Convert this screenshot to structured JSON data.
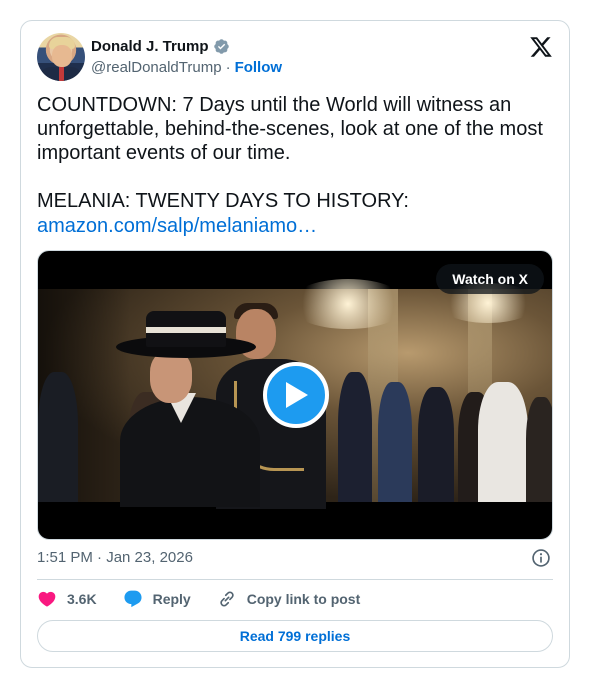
{
  "author": {
    "name": "Donald J. Trump",
    "handle": "@realDonaldTrump",
    "separator": "·",
    "follow_label": "Follow",
    "verified": true,
    "avatar_icon": "profile-avatar"
  },
  "platform_icon": "x-logo-icon",
  "tweet": {
    "text": "COUNTDOWN: 7 Days until the World will witness an\nunforgettable, behind-the-scenes, look at one of the most\nimportant events of our time.\n\nMELANIA: TWENTY DAYS TO HISTORY:",
    "link": "amazon.com/salp/melaniamo…"
  },
  "media": {
    "watch_label": "Watch on X",
    "play_icon": "play-icon"
  },
  "timestamp": "1:51 PM · Jan 23, 2026",
  "actions": {
    "like_count": "3.6K",
    "reply_label": "Reply",
    "copy_label": "Copy link to post"
  },
  "replies_button": "Read 799 replies",
  "colors": {
    "link": "#006fd6",
    "like": "#f91880",
    "reply_bubble": "#1d9bf0",
    "play": "#1d9bf0",
    "muted": "#536471",
    "border": "#cfd9de"
  }
}
